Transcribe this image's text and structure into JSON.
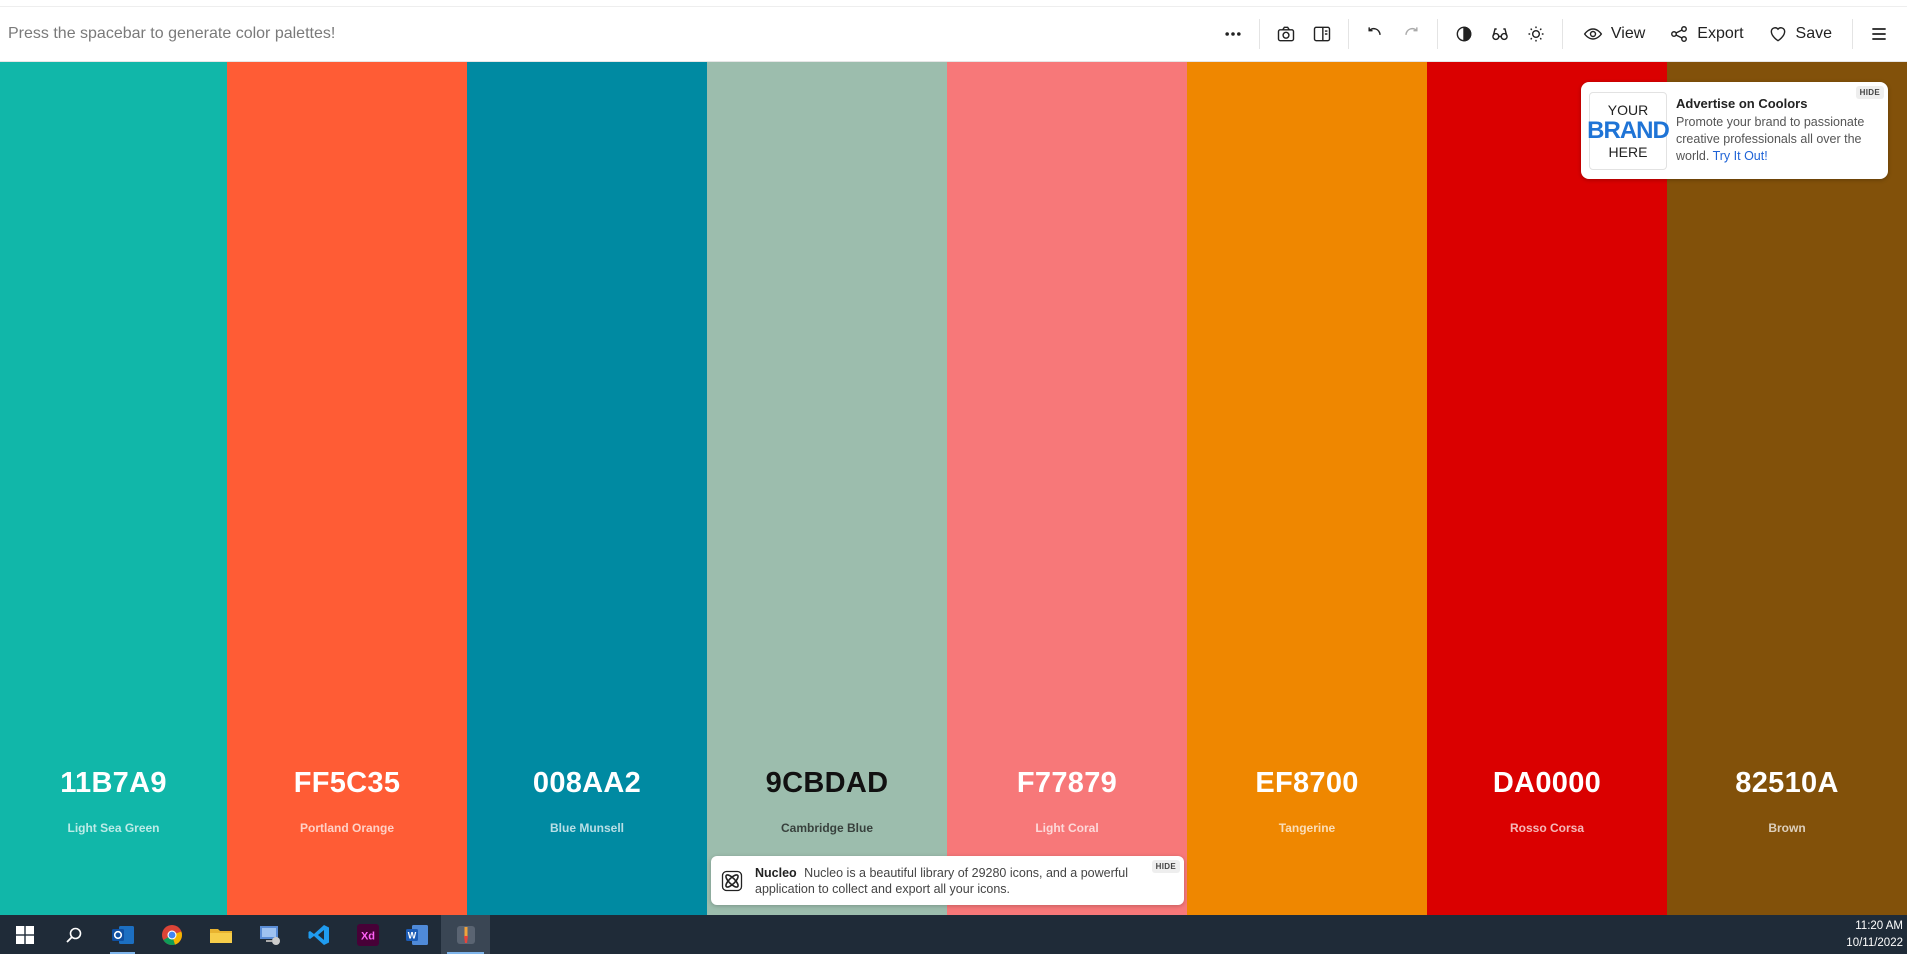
{
  "toolbar": {
    "hint": "Press the spacebar to generate color palettes!",
    "view_label": "View",
    "export_label": "Export",
    "save_label": "Save"
  },
  "palette": [
    {
      "hex": "11B7A9",
      "name": "Light Sea Green",
      "color": "#11B7A9",
      "text_color": "#ffffff",
      "width": 227
    },
    {
      "hex": "FF5C35",
      "name": "Portland Orange",
      "color": "#FF5C35",
      "text_color": "#ffffff",
      "width": 240
    },
    {
      "hex": "008AA2",
      "name": "Blue Munsell",
      "color": "#008AA2",
      "text_color": "#ffffff",
      "width": 240
    },
    {
      "hex": "9CBDAD",
      "name": "Cambridge Blue",
      "color": "#9CBDAD",
      "text_color": "#111111",
      "width": 240
    },
    {
      "hex": "F77879",
      "name": "Light Coral",
      "color": "#F77879",
      "text_color": "#ffffff",
      "width": 240
    },
    {
      "hex": "EF8700",
      "name": "Tangerine",
      "color": "#EF8700",
      "text_color": "#ffffff",
      "width": 240
    },
    {
      "hex": "DA0000",
      "name": "Rosso Corsa",
      "color": "#DA0000",
      "text_color": "#ffffff",
      "width": 240
    },
    {
      "hex": "82510A",
      "name": "Brown",
      "color": "#82510A",
      "text_color": "#ffffff",
      "width": 240
    }
  ],
  "ad": {
    "logo_line1": "YOUR",
    "logo_line2": "BRAND",
    "logo_line3": "HERE",
    "title": "Advertise on Coolors",
    "body": "Promote your brand to passionate creative professionals all over the world.",
    "link": "Try It Out!",
    "hide": "HIDE"
  },
  "nucleo": {
    "title": "Nucleo",
    "body": "Nucleo is a beautiful library of 29280 icons, and a powerful application to collect and export all your icons.",
    "hide": "HIDE"
  },
  "taskbar": {
    "time": "11:20 AM",
    "date": "10/11/2022"
  }
}
